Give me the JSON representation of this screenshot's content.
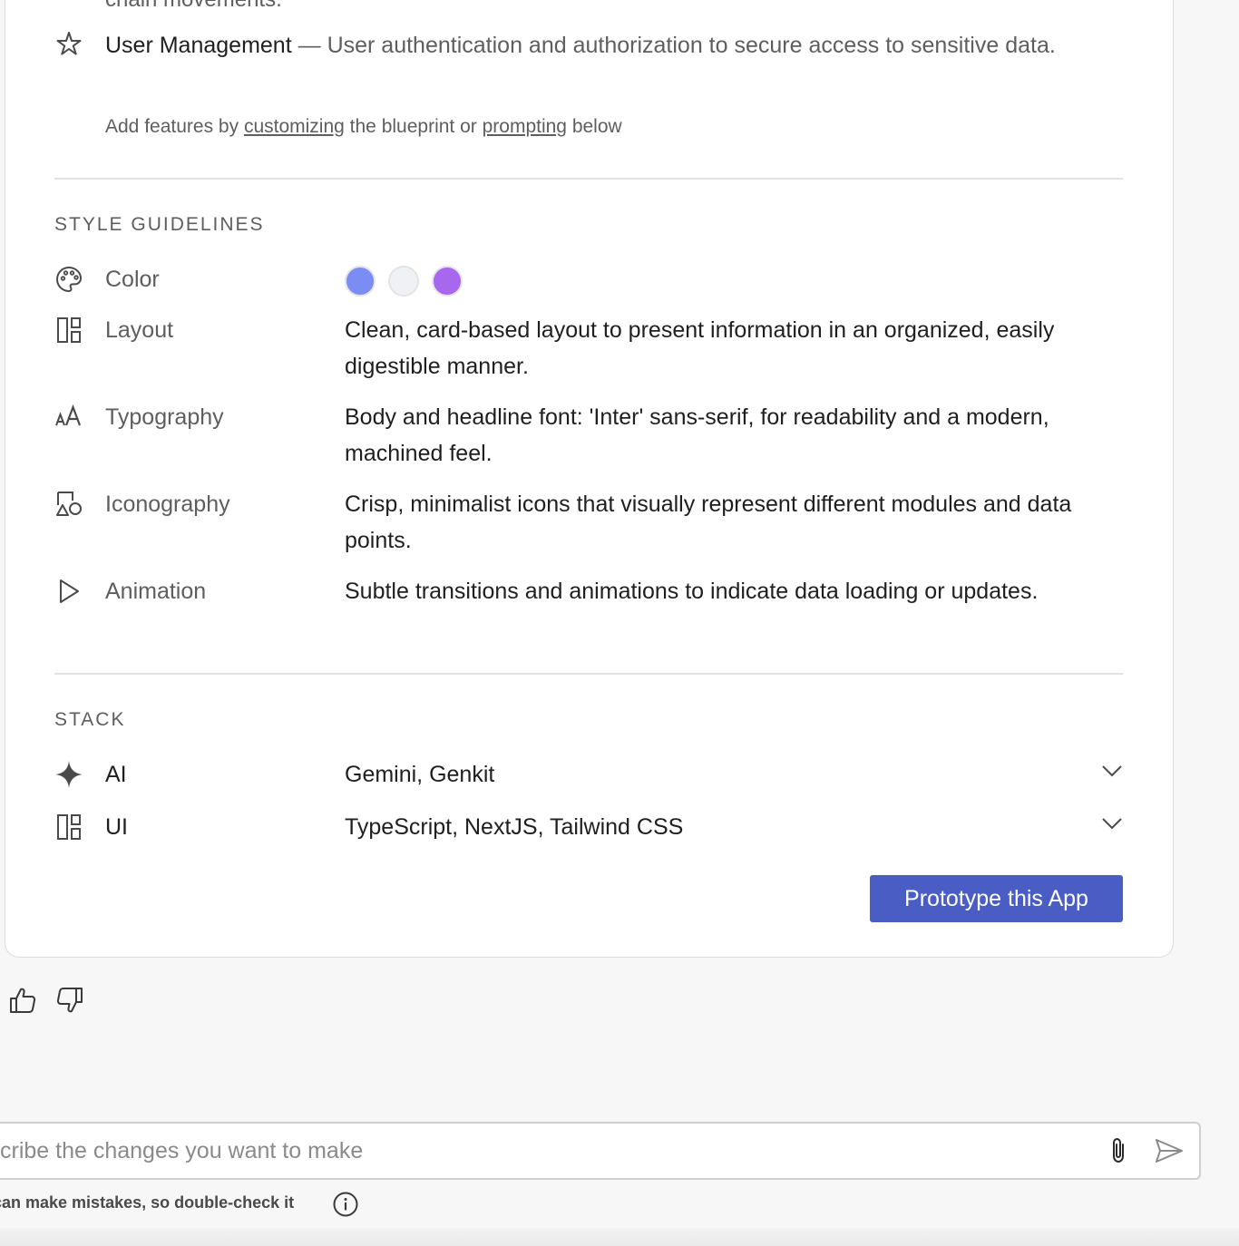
{
  "features": {
    "cut_text": "chain movements.",
    "item": {
      "icon": "star-icon",
      "name": "User Management",
      "separator": " — ",
      "description": "User authentication and authorization to secure access to sensitive data."
    },
    "hint": {
      "prefix": "Add features by ",
      "link1": "customizing",
      "middle": " the blueprint or ",
      "link2": "prompting",
      "suffix": " below"
    }
  },
  "style_guidelines": {
    "title": "STYLE GUIDELINES",
    "color": {
      "label": "Color",
      "icon": "palette-icon",
      "swatches": [
        "#7b8cf5",
        "#f0f1f4",
        "#a867ef"
      ]
    },
    "rows": [
      {
        "label": "Layout",
        "icon": "layout-icon",
        "description": "Clean, card-based layout to present information in an organized, easily digestible manner."
      },
      {
        "label": "Typography",
        "icon": "typography-icon",
        "description": "Body and headline font: 'Inter' sans-serif, for readability and a modern, machined feel."
      },
      {
        "label": "Iconography",
        "icon": "shapes-icon",
        "description": "Crisp, minimalist icons that visually represent different modules and data points."
      },
      {
        "label": "Animation",
        "icon": "play-icon",
        "description": "Subtle transitions and animations to indicate data loading or updates."
      }
    ]
  },
  "stack": {
    "title": "STACK",
    "rows": [
      {
        "label": "AI",
        "icon": "sparkle-icon",
        "value": "Gemini, Genkit"
      },
      {
        "label": "UI",
        "icon": "layout-icon",
        "value": "TypeScript, NextJS, Tailwind CSS"
      }
    ]
  },
  "cta": {
    "label": "Prototype this App",
    "color": "#4a5dc4"
  },
  "feedback": {
    "up_icon": "thumbs-up-icon",
    "down_icon": "thumbs-down-icon"
  },
  "composer": {
    "placeholder": "cribe the changes you want to make",
    "attach_icon": "paperclip-icon",
    "send_icon": "send-icon",
    "disclaimer": "can make mistakes, so double-check it",
    "info_icon": "info-icon"
  }
}
